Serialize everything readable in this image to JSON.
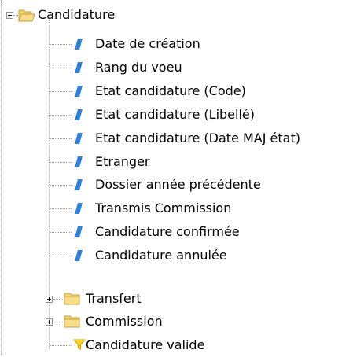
{
  "tree": {
    "root": {
      "label": "Candidature",
      "expanded": true,
      "icon": "folder-open-icon"
    },
    "fields": [
      {
        "label": "Date de création",
        "icon": "field-icon"
      },
      {
        "label": "Rang du voeu",
        "icon": "field-icon"
      },
      {
        "label": "Etat candidature (Code)",
        "icon": "field-icon"
      },
      {
        "label": "Etat candidature (Libellé)",
        "icon": "field-icon"
      },
      {
        "label": "Etat candidature (Date MAJ état)",
        "icon": "field-icon"
      },
      {
        "label": "Etranger",
        "icon": "field-icon"
      },
      {
        "label": "Dossier année précédente",
        "icon": "field-icon"
      },
      {
        "label": "Transmis Commission",
        "icon": "field-icon"
      },
      {
        "label": "Candidature confirmée",
        "icon": "field-icon"
      },
      {
        "label": "Candidature annulée",
        "icon": "field-icon"
      }
    ],
    "folders": [
      {
        "label": "Transfert",
        "expanded": false,
        "icon": "folder-icon"
      },
      {
        "label": "Commission",
        "expanded": false,
        "icon": "folder-icon"
      }
    ],
    "filter": {
      "label": "Candidature valide",
      "icon": "filter-icon"
    }
  },
  "colors": {
    "field_icon": "#2f80d8",
    "folder_fill": "#f4d172",
    "folder_edge": "#c9a13b",
    "filter_fill": "#ffd21a",
    "tree_line": "#a0a0a0"
  }
}
